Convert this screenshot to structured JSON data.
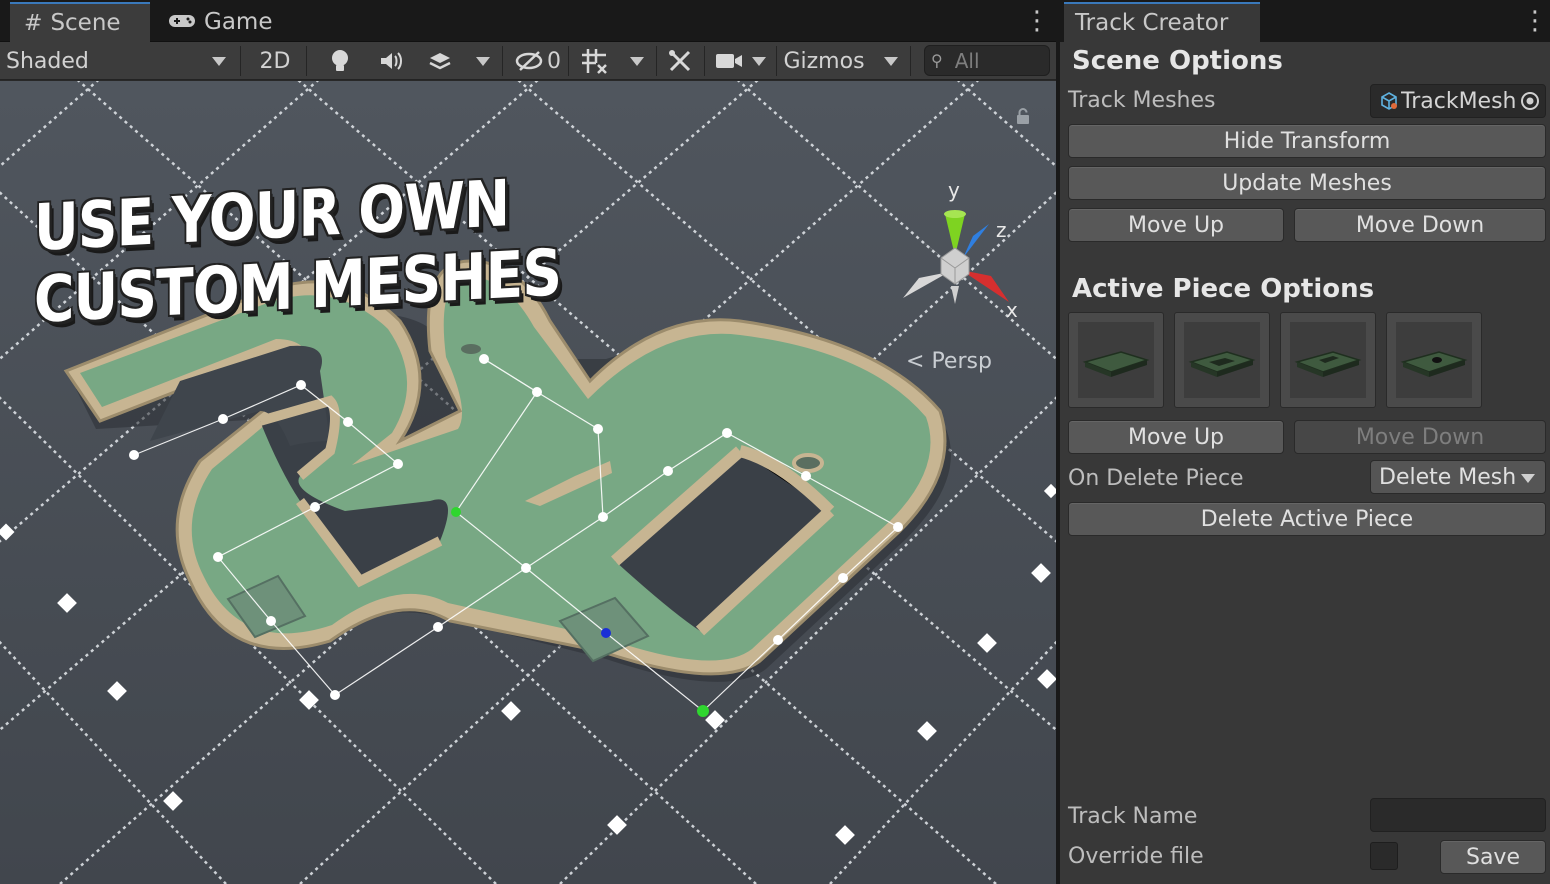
{
  "scene_tabs": {
    "scene_label": "Scene",
    "game_label": "Game"
  },
  "toolbar": {
    "shading_mode": "Shaded",
    "two_d_label": "2D",
    "hidden_count": "0",
    "gizmos_label": "Gizmos",
    "search_placeholder": "All"
  },
  "viewport": {
    "headline_line1": "USE YOUR OWN",
    "headline_line2": "CUSTOM MESHES",
    "projection_label": "Persp",
    "axis_x": "x",
    "axis_y": "y",
    "axis_z": "z",
    "colors": {
      "track_surface": "#78a884",
      "track_border": "#c9b895",
      "floor": "#4a5059",
      "grid_line": "#e8ecf0",
      "control_point_white": "#ffffff",
      "control_point_green": "#2fd62f",
      "control_point_blue": "#1a2fd6"
    }
  },
  "inspector": {
    "tab_title": "Track Creator",
    "scene_options": {
      "header": "Scene Options",
      "track_meshes_label": "Track Meshes",
      "track_meshes_value": "TrackMeshes",
      "hide_transform_button": "Hide Transform",
      "update_meshes_button": "Update Meshes",
      "move_up_button": "Move Up",
      "move_down_button": "Move Down"
    },
    "active_piece_options": {
      "header": "Active Piece Options",
      "mesh_thumbnails": [
        "straight-piece",
        "hole-piece-a",
        "hole-piece-b",
        "cup-piece"
      ],
      "move_up_button": "Move Up",
      "move_down_button": "Move Down",
      "on_delete_label": "On Delete Piece",
      "on_delete_value": "Delete Mesh",
      "delete_active_button": "Delete Active Piece"
    },
    "save_section": {
      "track_name_label": "Track Name",
      "track_name_value": "",
      "override_label": "Override file",
      "override_checked": false,
      "save_button": "Save"
    },
    "colors": {
      "accent_tab": "#3a79bb",
      "panel_bg": "#383838",
      "button_bg": "#585858"
    }
  }
}
